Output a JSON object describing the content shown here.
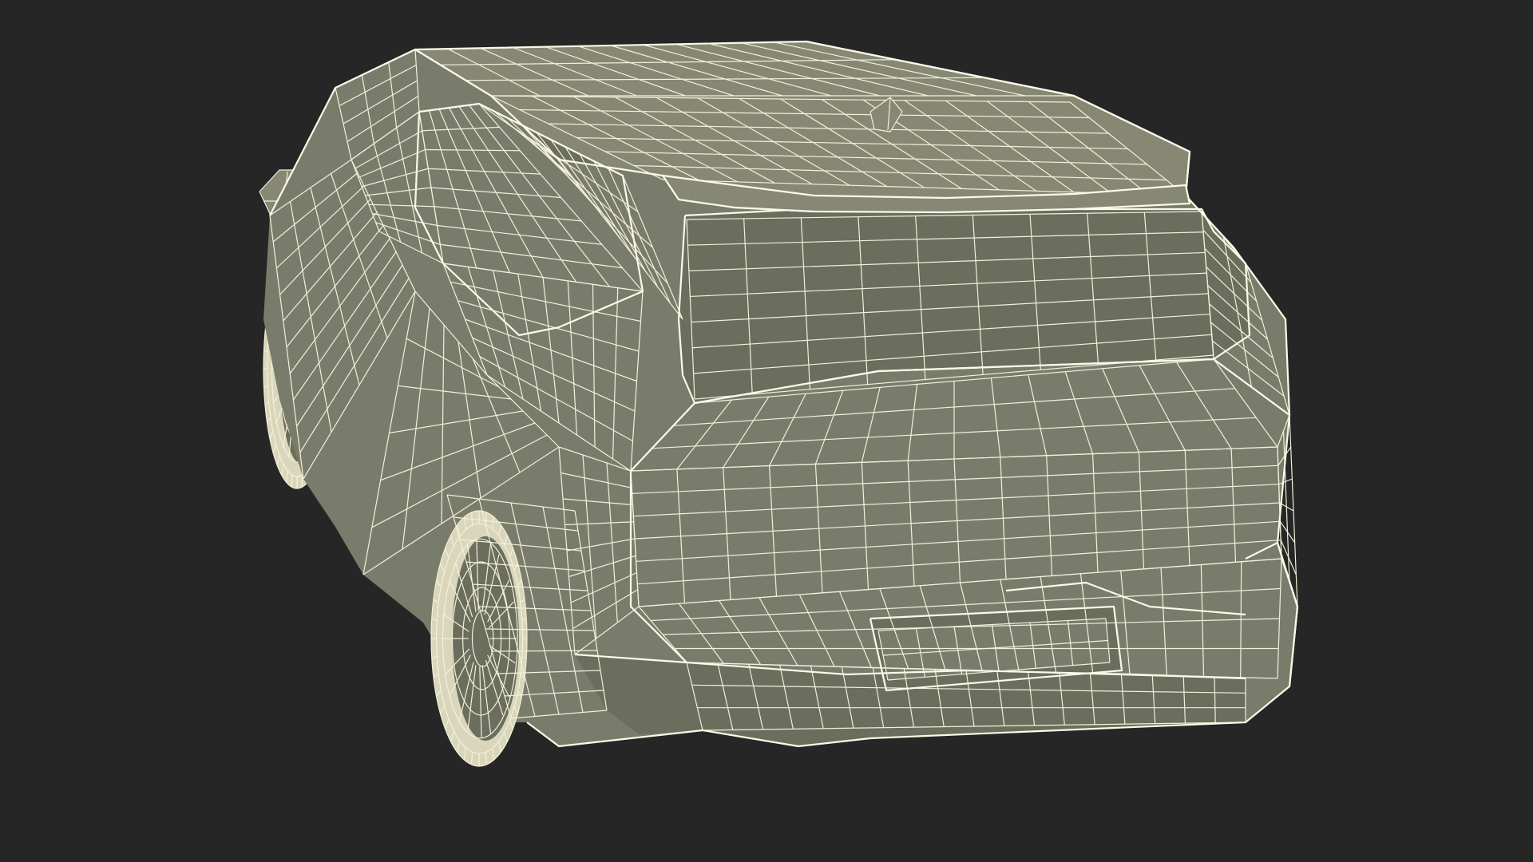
{
  "viewport": {
    "background_color": "#262626",
    "subject": "suv-wireframe-rear-three-quarter",
    "render_mode": "wireframe-on-shaded"
  },
  "colors": {
    "surface": "#7a7c6b",
    "surface_dark": "#6b6d5d",
    "surface_light": "#868873",
    "wire": "#f2f0d8",
    "wire_heavy": "#fbfae8",
    "tire": "#d9d6bc"
  }
}
